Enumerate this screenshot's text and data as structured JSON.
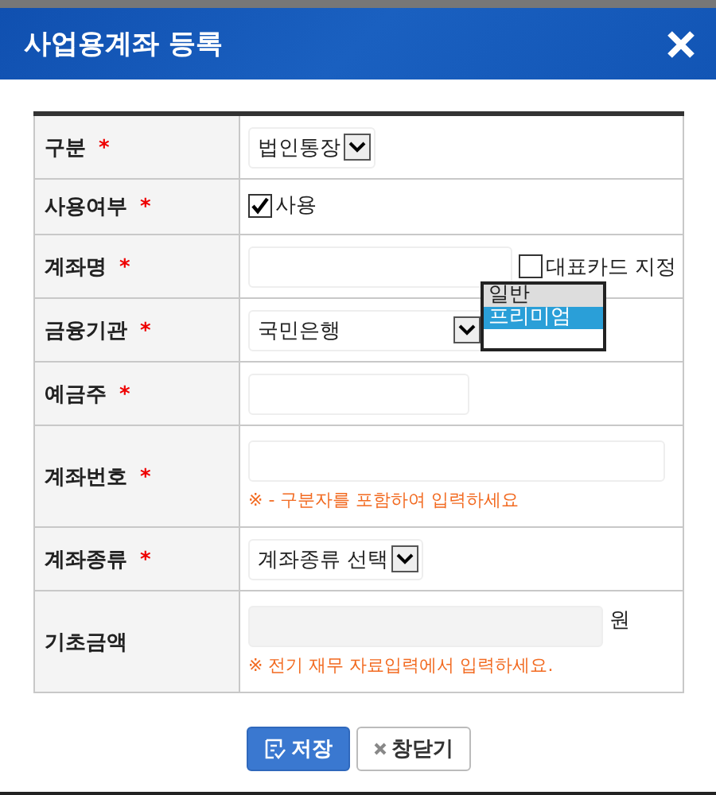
{
  "dialog": {
    "title": "사업용계좌 등록"
  },
  "rows": [
    {
      "kind": "select",
      "label": "구분",
      "mark": "*",
      "value": "법인통장"
    },
    {
      "kind": "checkbox",
      "label": "사용여부",
      "mark": "*",
      "checked": true,
      "option": "사용"
    },
    {
      "kind": "text_check",
      "label": "계좌명",
      "mark": "*",
      "checked": false,
      "option": "대표카드 지정"
    },
    {
      "kind": "select",
      "label": "금융기관",
      "mark": "*",
      "value": "국민은행"
    },
    {
      "kind": "text",
      "label": "예금주",
      "mark": "*"
    },
    {
      "kind": "text_hint",
      "label": "계좌번호",
      "mark": "*",
      "hint": "※ - 구분자를 포함하여 입력하세요"
    },
    {
      "kind": "select",
      "label": "계좌종류",
      "mark": "*",
      "value": "계좌종류 선택"
    },
    {
      "kind": "readonly_hint",
      "label": "기초금액",
      "unit": "원",
      "hint": "※ 전기 재무 자료입력에서 입력하세요."
    }
  ],
  "dropdown": {
    "options": [
      {
        "label": "일반",
        "selected": false
      },
      {
        "label": "프리미엄",
        "selected": true
      }
    ]
  },
  "buttons": [
    {
      "kind": "primary",
      "label": "저장"
    },
    {
      "kind": "secondary",
      "label": "창닫기"
    }
  ]
}
